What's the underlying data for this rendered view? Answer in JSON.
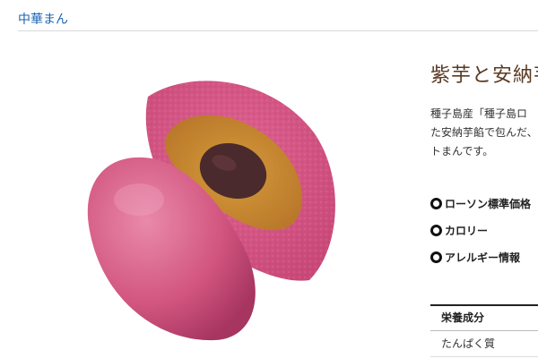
{
  "breadcrumb": {
    "label": "中華まん"
  },
  "product": {
    "title": "紫芋と安納芋",
    "description_lines": [
      "種子島産「種子島ロ",
      "た安納芋餡で包んだ、",
      "トまんです。"
    ],
    "image_name": "purple-sweet-potato-bun-photo"
  },
  "info_links": [
    {
      "label": "ローソン標準価格"
    },
    {
      "label": "カロリー"
    },
    {
      "label": "アレルギー情報"
    }
  ],
  "nutrition": {
    "header": "栄養成分",
    "rows": [
      {
        "label": "たんぱく質"
      }
    ]
  },
  "colors": {
    "link": "#1a62b5",
    "title": "#5a3a22",
    "bun": "#d95a86",
    "filling": "#c98a2e",
    "bean_paste": "#4a2a2c"
  }
}
